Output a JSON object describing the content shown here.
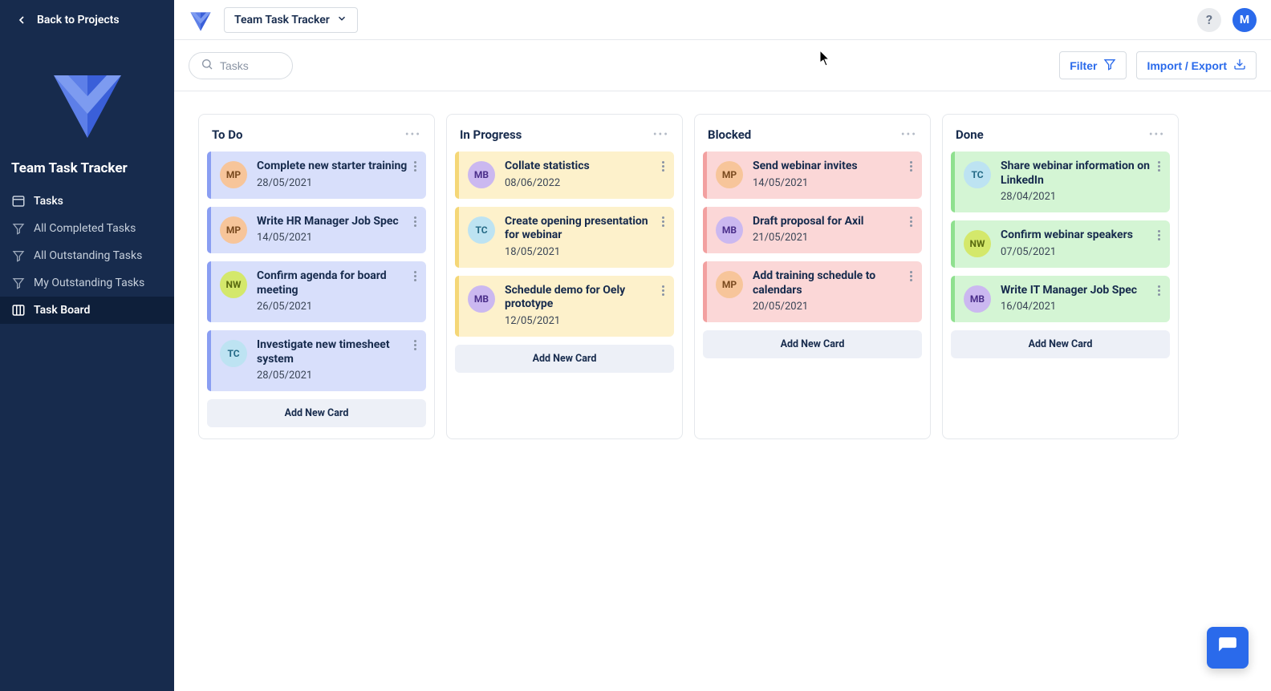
{
  "back_label": "Back to Projects",
  "project_name": "Team Task Tracker",
  "nav": {
    "items": [
      {
        "label": "Tasks"
      },
      {
        "label": "All Completed Tasks"
      },
      {
        "label": "All Outstanding Tasks"
      },
      {
        "label": "My Outstanding Tasks"
      },
      {
        "label": "Task Board"
      }
    ]
  },
  "search_placeholder": "Tasks",
  "filter_label": "Filter",
  "import_label": "Import / Export",
  "help_symbol": "?",
  "user_initial": "M",
  "add_card_label": "Add New Card",
  "columns": [
    {
      "title": "To Do",
      "color": "blue",
      "cards": [
        {
          "assignee": "MP",
          "title": "Complete new starter training",
          "date": "28/05/2021"
        },
        {
          "assignee": "MP",
          "title": "Write HR Manager Job Spec",
          "date": "14/05/2021"
        },
        {
          "assignee": "NW",
          "title": "Confirm agenda for board meeting",
          "date": "26/05/2021"
        },
        {
          "assignee": "TC",
          "title": "Investigate new timesheet system",
          "date": "28/05/2021"
        }
      ]
    },
    {
      "title": "In Progress",
      "color": "yellow",
      "cards": [
        {
          "assignee": "MB",
          "title": "Collate statistics",
          "date": "08/06/2022"
        },
        {
          "assignee": "TC",
          "title": "Create opening presentation for webinar",
          "date": "18/05/2021"
        },
        {
          "assignee": "MB",
          "title": "Schedule demo for Oely prototype",
          "date": "12/05/2021"
        }
      ]
    },
    {
      "title": "Blocked",
      "color": "red",
      "cards": [
        {
          "assignee": "MP",
          "title": "Send webinar invites",
          "date": "14/05/2021"
        },
        {
          "assignee": "MB",
          "title": "Draft proposal for Axil",
          "date": "21/05/2021"
        },
        {
          "assignee": "MP",
          "title": "Add training schedule to calendars",
          "date": "20/05/2021"
        }
      ]
    },
    {
      "title": "Done",
      "color": "green",
      "cards": [
        {
          "assignee": "TC",
          "title": "Share webinar information on LinkedIn",
          "date": "28/04/2021"
        },
        {
          "assignee": "NW",
          "title": "Confirm webinar speakers",
          "date": "07/05/2021"
        },
        {
          "assignee": "MB",
          "title": "Write IT Manager Job Spec",
          "date": "16/04/2021"
        }
      ]
    }
  ]
}
